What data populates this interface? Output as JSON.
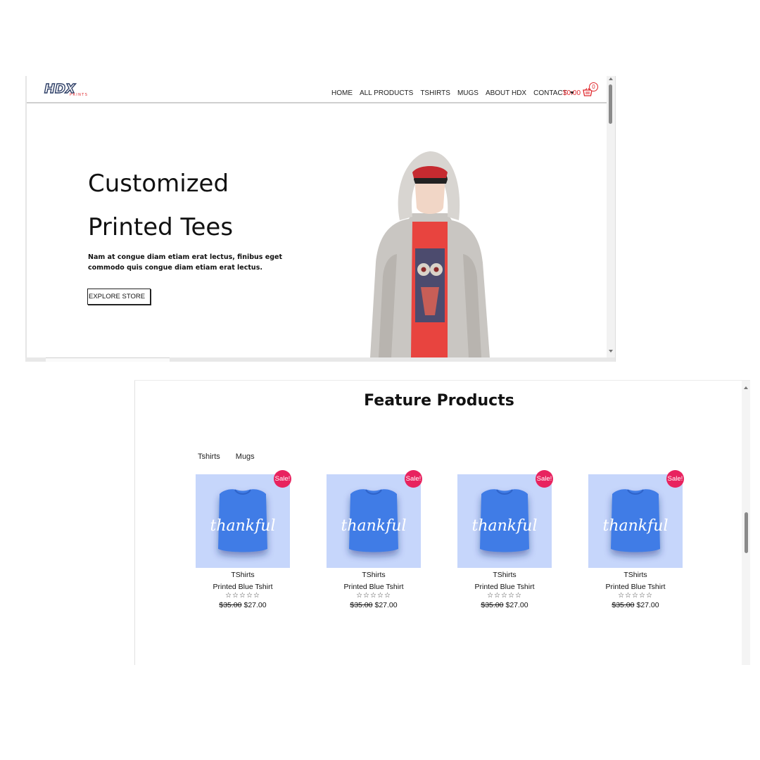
{
  "header": {
    "logo_text": "HDX",
    "logo_sub": "PRINTS",
    "nav": [
      "HOME",
      "ALL PRODUCTS",
      "TSHIRTS",
      "MUGS",
      "ABOUT HDX",
      "CONTACT"
    ],
    "cart_total": "$0.00",
    "cart_count": "0",
    "brand_color": "#e0262b"
  },
  "hero": {
    "title_line1": "Customized",
    "title_line2": "Printed Tees",
    "description": "Nam at congue diam etiam erat lectus, finibus eget commodo quis congue diam etiam erat lectus.",
    "button_label": "EXPLORE STORE"
  },
  "featured": {
    "title": "Feature Products",
    "tabs": [
      "Tshirts",
      "Mugs"
    ],
    "products": [
      {
        "badge": "Sale!",
        "category": "TShirts",
        "name": "Printed Blue Tshirt",
        "rating": "☆☆☆☆☆",
        "old_price": "$35.00",
        "price": "$27.00",
        "print_text": "thankful"
      },
      {
        "badge": "Sale!",
        "category": "TShirts",
        "name": "Printed Blue Tshirt",
        "rating": "☆☆☆☆☆",
        "old_price": "$35.00",
        "price": "$27.00",
        "print_text": "thankful"
      },
      {
        "badge": "Sale!",
        "category": "TShirts",
        "name": "Printed Blue Tshirt",
        "rating": "☆☆☆☆☆",
        "old_price": "$35.00",
        "price": "$27.00",
        "print_text": "thankful"
      },
      {
        "badge": "Sale!",
        "category": "TShirts",
        "name": "Printed Blue Tshirt",
        "rating": "☆☆☆☆☆",
        "old_price": "$35.00",
        "price": "$27.00",
        "print_text": "thankful"
      }
    ],
    "badge_color": "#e8235f",
    "product_bg": "#c6d6fb"
  }
}
